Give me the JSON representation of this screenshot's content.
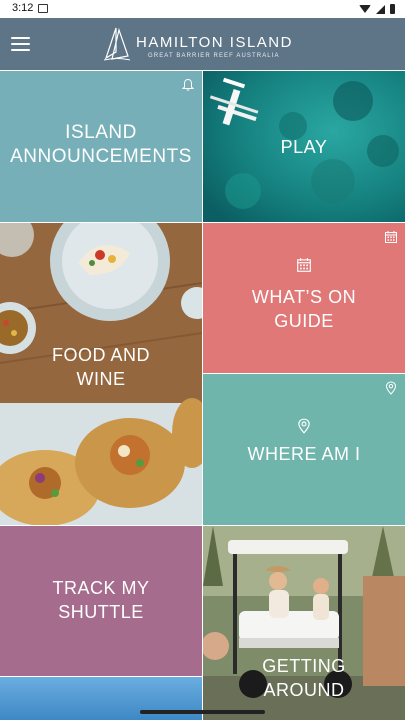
{
  "status_bar": {
    "time": "3:12"
  },
  "header": {
    "logo_title": "HAMILTON ISLAND",
    "logo_subtitle": "GREAT BARRIER REEF AUSTRALIA",
    "menu_icon": "hamburger-menu-icon"
  },
  "tiles": {
    "announcements": {
      "label": "ISLAND ANNOUNCEMENTS",
      "icon": "bell-icon",
      "color": "#77afb9"
    },
    "play": {
      "label": "PLAY"
    },
    "food": {
      "label_line1": "FOOD AND",
      "label_line2": "WINE"
    },
    "whatson": {
      "label_line1": "WHAT’S ON",
      "label_line2": "GUIDE",
      "icon": "calendar-icon",
      "color": "#e07878"
    },
    "whereami": {
      "label": "WHERE AM I",
      "icon": "location-pin-icon",
      "color": "#6fb5ac"
    },
    "shuttle": {
      "label_line1": "TRACK MY",
      "label_line2": "SHUTTLE",
      "color": "#a56c8d"
    },
    "around": {
      "label_line1": "GETTING",
      "label_line2": "AROUND"
    }
  },
  "colors": {
    "header": "#5e7487"
  }
}
